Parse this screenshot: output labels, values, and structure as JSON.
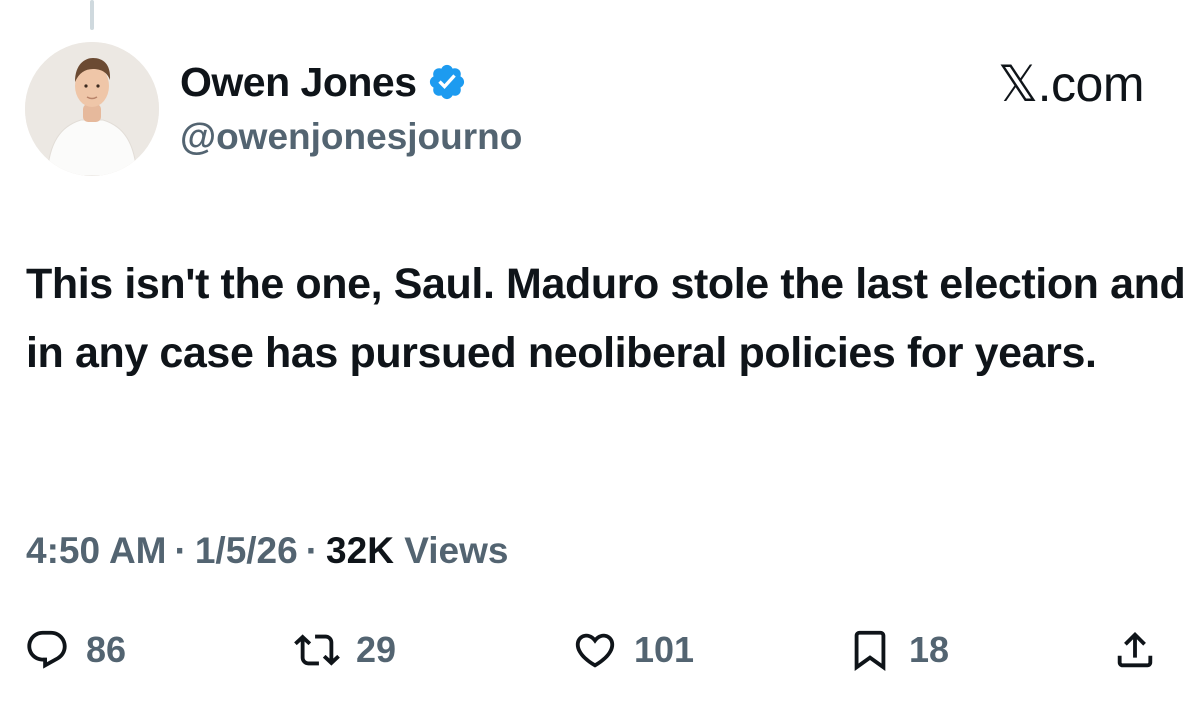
{
  "author": {
    "display_name": "Owen Jones",
    "handle": "@owenjonesjourno",
    "verified": true,
    "verified_color": "#1d9bf0"
  },
  "site_logo": "𝕏.com",
  "tweet": {
    "text": "This isn't the one, Saul. Maduro stole the last election and in any case has pursued neoliberal policies for years."
  },
  "meta": {
    "time": "4:50 AM",
    "separator": "·",
    "date": "1/5/26",
    "views_count": "32K",
    "views_label": "Views"
  },
  "actions": {
    "replies": "86",
    "reposts": "29",
    "likes": "101",
    "bookmarks": "18"
  },
  "colors": {
    "text_primary": "#0f1419",
    "text_secondary": "#536471",
    "accent": "#1d9bf0"
  },
  "icons": [
    "reply-icon",
    "repost-icon",
    "like-icon",
    "bookmark-icon",
    "share-icon",
    "verified-badge-icon"
  ]
}
